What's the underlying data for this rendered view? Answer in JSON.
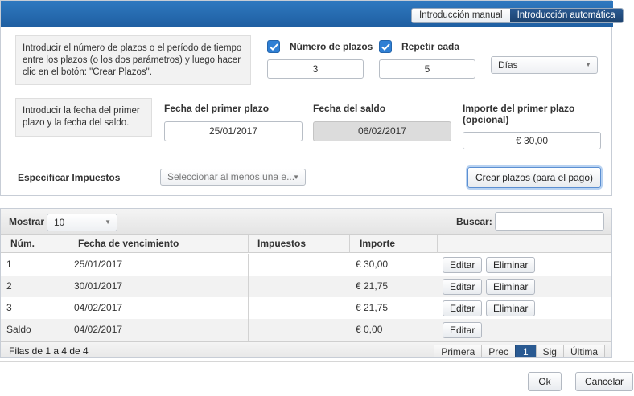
{
  "mode_toggle": {
    "manual": "Introducción manual",
    "auto": "Introducción automática"
  },
  "plazos_section": {
    "info": "Introducir el número de plazos o el período de tiempo entre los plazos (o los dos parámetros) y luego hacer clic en el botón: \"Crear Plazos\".",
    "numero_label": "Número de plazos",
    "numero_value": "3",
    "repetir_label": "Repetir cada",
    "repetir_value": "5",
    "unidad_value": "Días"
  },
  "fechas_section": {
    "info": "Introducir la fecha del primer plazo y la fecha del saldo.",
    "primer_plazo_label": "Fecha del primer plazo",
    "primer_plazo_value": "25/01/2017",
    "saldo_label": "Fecha del saldo",
    "saldo_value": "06/02/2017",
    "importe_label_line1": "Importe del primer plazo",
    "importe_label_line2": "(opcional)",
    "importe_value": "€ 30,00"
  },
  "impuestos": {
    "label": "Especificar Impuestos",
    "placeholder": "Seleccionar al menos una e..."
  },
  "crear_button": "Crear plazos (para el pago)",
  "table": {
    "mostrar_label": "Mostrar",
    "mostrar_value": "10",
    "buscar_label": "Buscar:",
    "buscar_value": "",
    "headers": [
      "Núm.",
      "Fecha de vencimiento",
      "Impuestos",
      "Importe"
    ],
    "rows": [
      {
        "num": "1",
        "fecha": "25/01/2017",
        "impuestos": "",
        "importe": "€ 30,00",
        "edit": "Editar",
        "delete": "Eliminar"
      },
      {
        "num": "2",
        "fecha": "30/01/2017",
        "impuestos": "",
        "importe": "€ 21,75",
        "edit": "Editar",
        "delete": "Eliminar"
      },
      {
        "num": "3",
        "fecha": "04/02/2017",
        "impuestos": "",
        "importe": "€ 21,75",
        "edit": "Editar",
        "delete": "Eliminar"
      },
      {
        "num": "Saldo",
        "fecha": "04/02/2017",
        "impuestos": "",
        "importe": "€ 0,00",
        "edit": "Editar"
      }
    ],
    "info": "Filas de 1 a 4 de 4",
    "pager": {
      "first": "Primera",
      "prev": "Prec",
      "current": "1",
      "next": "Sig",
      "last": "Última"
    }
  },
  "dialog_buttons": {
    "ok": "Ok",
    "cancel": "Cancelar"
  }
}
